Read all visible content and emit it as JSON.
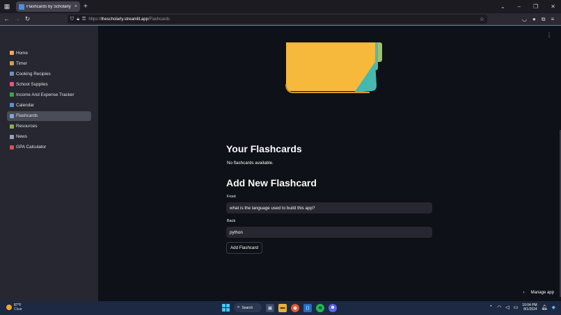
{
  "browser": {
    "tab_title": "Flashcards by Scholarly · Stream",
    "tab_close": "×",
    "new_tab": "+",
    "url_prefix": "https://",
    "url_host": "thescholarly.streamlit.app",
    "url_path": "/Flashcards",
    "window_controls": [
      "⌄",
      "–",
      "❐",
      "✕"
    ]
  },
  "sidebar": {
    "items": [
      {
        "label": "Home",
        "color": "#f2a65a",
        "active": false
      },
      {
        "label": "Timer",
        "color": "#c9a15c",
        "active": false
      },
      {
        "label": "Cooking Recipies",
        "color": "#6f8fb8",
        "active": false
      },
      {
        "label": "School Supplies",
        "color": "#e05a7a",
        "active": false
      },
      {
        "label": "Income And Expense Tracker",
        "color": "#3fa34d",
        "active": false
      },
      {
        "label": "Calendar",
        "color": "#5b8fd9",
        "active": false
      },
      {
        "label": "Flashcards",
        "color": "#7fa7d6",
        "active": true
      },
      {
        "label": "Resources",
        "color": "#88b04b",
        "active": false
      },
      {
        "label": "News",
        "color": "#9aa3b5",
        "active": false
      },
      {
        "label": "GPA Calculator",
        "color": "#d9534f",
        "active": false
      }
    ]
  },
  "main": {
    "flashcards_heading": "Your Flashcards",
    "empty_message": "No flashcards available.",
    "add_heading": "Add New Flashcard",
    "front_label": "Front",
    "front_value": "what is the language used to build this app?",
    "back_label": "Back",
    "back_value": "python",
    "add_button": "Add Flashcard",
    "manage_app": "Manage app",
    "manage_chevron": "‹"
  },
  "taskbar": {
    "weather_temp": "87°F",
    "weather_cond": "Clear",
    "search_label": "Search",
    "time": "10:04 PM",
    "date": "8/1/2024"
  },
  "colors": {
    "accent": "#ff4b4b",
    "app_bg": "#0e1117",
    "sidebar_bg": "#262730"
  }
}
